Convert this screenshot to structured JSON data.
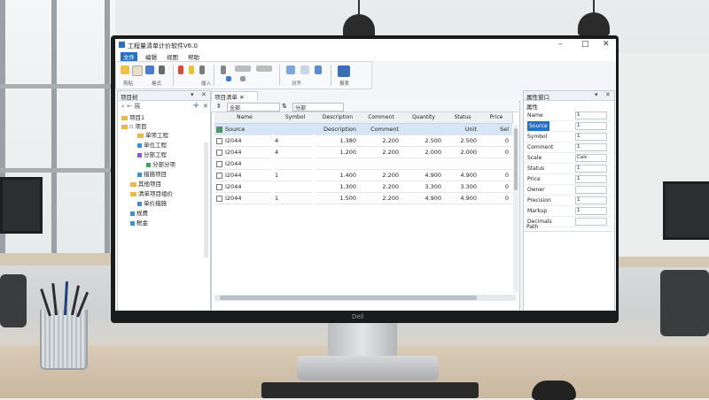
{
  "window": {
    "title": "工程量清单计价软件V6.0"
  },
  "menu": [
    {
      "label": "文件",
      "active": true
    },
    {
      "label": "编辑"
    },
    {
      "label": "视图"
    },
    {
      "label": "帮助"
    }
  ],
  "ribbon": {
    "group_labels": [
      "剪贴",
      "格式",
      "插入",
      "对齐",
      "报表"
    ]
  },
  "project_tree": {
    "title": "项目树",
    "items": [
      {
        "label": "项目1"
      },
      {
        "label": "▫ 项目"
      },
      {
        "label": "单项工程"
      },
      {
        "label": "单位工程"
      },
      {
        "label": "分部工程"
      },
      {
        "label": "分部分项"
      },
      {
        "label": "措施项目"
      },
      {
        "label": "其他项目"
      },
      {
        "label": "清单项目组价"
      },
      {
        "label": "单价措施"
      },
      {
        "label": "规费"
      },
      {
        "label": "税金"
      }
    ]
  },
  "grid": {
    "tab_label": "项目清单",
    "toolbar": {
      "combo1": "全部",
      "combo2": "分部"
    },
    "columns": [
      "Name",
      "Symbol",
      "Description",
      "Comment",
      "Quantity",
      "Status",
      "Price"
    ],
    "rows": [
      {
        "name": "Source",
        "symbol": "",
        "desc": "Description",
        "comment": "Comment",
        "qty": "",
        "status": "Unit",
        "price": "Sel",
        "selected": true
      },
      {
        "name": "I2044",
        "symbol": "4",
        "desc": "1.380",
        "comment": "2.200",
        "qty": "2.500",
        "status": "2.500",
        "price": "0"
      },
      {
        "name": "I2044",
        "symbol": "4",
        "desc": "1.200",
        "comment": "2.200",
        "qty": "2.000",
        "status": "2.000",
        "price": "0"
      },
      {
        "name": "I2044",
        "symbol": "",
        "desc": "",
        "comment": "",
        "qty": "",
        "status": "",
        "price": ""
      },
      {
        "name": "I2044",
        "symbol": "1",
        "desc": "1.400",
        "comment": "2.200",
        "qty": "4.900",
        "status": "4.900",
        "price": "0"
      },
      {
        "name": "I2044",
        "symbol": "",
        "desc": "1.300",
        "comment": "2.200",
        "qty": "3.300",
        "status": "3.300",
        "price": "0"
      },
      {
        "name": "I2044",
        "symbol": "1",
        "desc": "1.500",
        "comment": "2.200",
        "qty": "4.900",
        "status": "4.900",
        "price": "0"
      }
    ]
  },
  "properties": {
    "title": "属性窗口",
    "section": "属性",
    "rows": [
      {
        "label": "Name",
        "value": "1"
      },
      {
        "label": "Source",
        "value": "1",
        "selected": true
      },
      {
        "label": "Symbol",
        "value": "1"
      },
      {
        "label": "Comment",
        "value": "1"
      },
      {
        "label": "Scale",
        "value": "Calc"
      },
      {
        "label": "Status",
        "value": "1"
      },
      {
        "label": "Price",
        "value": "1"
      },
      {
        "label": "Owner",
        "value": ""
      },
      {
        "label": "Precision",
        "value": "1"
      },
      {
        "label": "Markup",
        "value": "1"
      },
      {
        "label": "Decimals",
        "value": ""
      }
    ],
    "footer": "Path"
  },
  "device": {
    "brand": "Dell"
  }
}
